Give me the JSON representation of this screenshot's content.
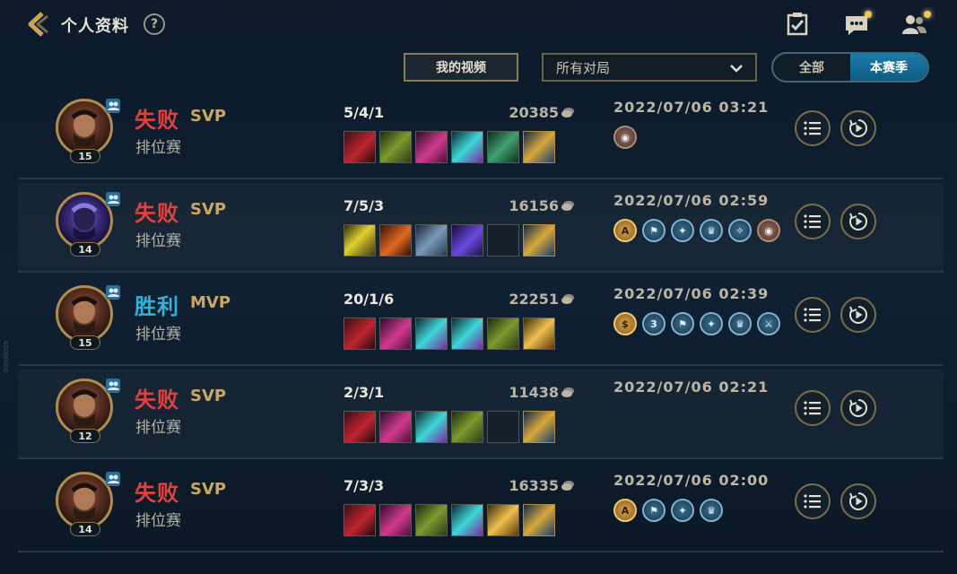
{
  "header": {
    "title": "个人资料",
    "help_label": "?",
    "icons": [
      "back-icon",
      "checklist-icon",
      "chat-icon",
      "friends-icon"
    ]
  },
  "filters": {
    "videos_button": "我的视频",
    "match_filter": "所有对局",
    "segment_all": "全部",
    "segment_season": "本赛季"
  },
  "colors": {
    "loss": "#e0413f",
    "win": "#2fb3d7",
    "gold_frame": "#b08d4e",
    "season_active": "#1c7ba6"
  },
  "side_watermark": "00000009",
  "matches": [
    {
      "result": "失败",
      "outcome": "loss",
      "rank_tag": "SVP",
      "mode": "排位赛",
      "level": "15",
      "champion": "graves",
      "kda": "5/4/1",
      "gold": "20385",
      "time": "2022/07/06 03:21",
      "items": [
        "item-red",
        "item-green",
        "item-pink",
        "item-teal",
        "item-jade",
        "item-trinket"
      ],
      "badges": [
        "bronze"
      ]
    },
    {
      "result": "失败",
      "outcome": "loss",
      "rank_tag": "SVP",
      "mode": "排位赛",
      "level": "14",
      "champion": "zed",
      "kda": "7/5/3",
      "gold": "16156",
      "time": "2022/07/06 02:59",
      "items": [
        "item-yellow",
        "item-orange",
        "item-steel",
        "item-purple",
        "empty",
        "item-trinket"
      ],
      "badges": [
        "A",
        "flag",
        "wind",
        "crown",
        "star",
        "bronze"
      ]
    },
    {
      "result": "胜利",
      "outcome": "win",
      "rank_tag": "MVP",
      "mode": "排位赛",
      "level": "15",
      "champion": "graves",
      "kda": "20/1/6",
      "gold": "22251",
      "time": "2022/07/06 02:39",
      "items": [
        "item-red",
        "item-pink",
        "item-teal",
        "item-teal",
        "item-green",
        "item-gold"
      ],
      "badges": [
        "S",
        "3",
        "flag",
        "wind",
        "crown",
        "sword"
      ]
    },
    {
      "result": "失败",
      "outcome": "loss",
      "rank_tag": "SVP",
      "mode": "排位赛",
      "level": "12",
      "champion": "graves",
      "kda": "2/3/1",
      "gold": "11438",
      "time": "2022/07/06 02:21",
      "items": [
        "item-red",
        "item-pink",
        "item-teal",
        "item-green",
        "empty",
        "item-trinket"
      ],
      "badges": []
    },
    {
      "result": "失败",
      "outcome": "loss",
      "rank_tag": "SVP",
      "mode": "排位赛",
      "level": "14",
      "champion": "graves",
      "kda": "7/3/3",
      "gold": "16335",
      "time": "2022/07/06 02:00",
      "items": [
        "item-red",
        "item-pink",
        "item-green",
        "item-teal",
        "item-gold",
        "item-trinket"
      ],
      "badges": [
        "A",
        "flag",
        "wind",
        "crown"
      ]
    }
  ]
}
